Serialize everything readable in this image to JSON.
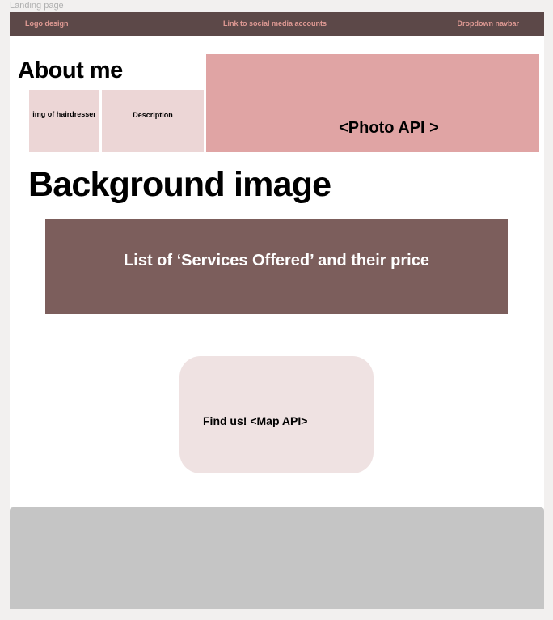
{
  "frame": {
    "label": "Landing page"
  },
  "navbar": {
    "logo": "Logo design",
    "social": "Link to social media accounts",
    "dropdown": "Dropdown navbar"
  },
  "about": {
    "title": "About me",
    "image_placeholder": "img of hairdresser",
    "description": "Description"
  },
  "photo_api": {
    "label": "<Photo API >"
  },
  "background": {
    "title": "Background image"
  },
  "services": {
    "label": "List of ‘Services Offered’ and their price"
  },
  "map": {
    "label": "Find us! <Map API>"
  },
  "colors": {
    "navbar": "#5c4848",
    "nav_text": "#e09a94",
    "photo": "#e0a4a4",
    "services": "#7c5e5c",
    "tiles": "#ecd6d6",
    "map": "#efe2e2",
    "footer": "#c5c5c5"
  }
}
